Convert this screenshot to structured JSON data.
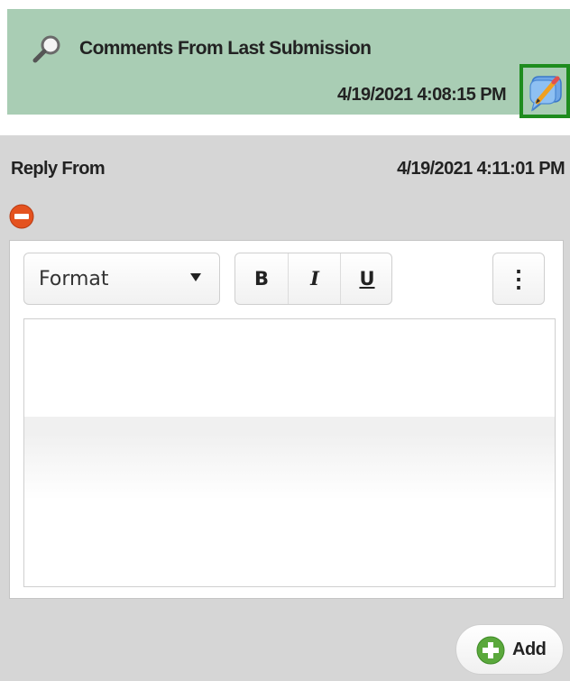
{
  "comments_panel": {
    "title": "Comments From Last Submission",
    "date": "4/19/2021 4:08:15 PM",
    "background": "#a9cdb4",
    "highlight_color": "#1e8c1e"
  },
  "reply": {
    "label": "Reply From",
    "date": "4/19/2021 4:11:01 PM"
  },
  "editor": {
    "format_label": "Format",
    "bold": "B",
    "italic": "I",
    "underline": "U",
    "more": "⋮",
    "content": ""
  },
  "actions": {
    "add_label": "Add"
  },
  "icons": {
    "search": "magnifier-icon",
    "edit": "edit-comment-icon",
    "remove": "remove-icon",
    "add": "add-icon"
  }
}
